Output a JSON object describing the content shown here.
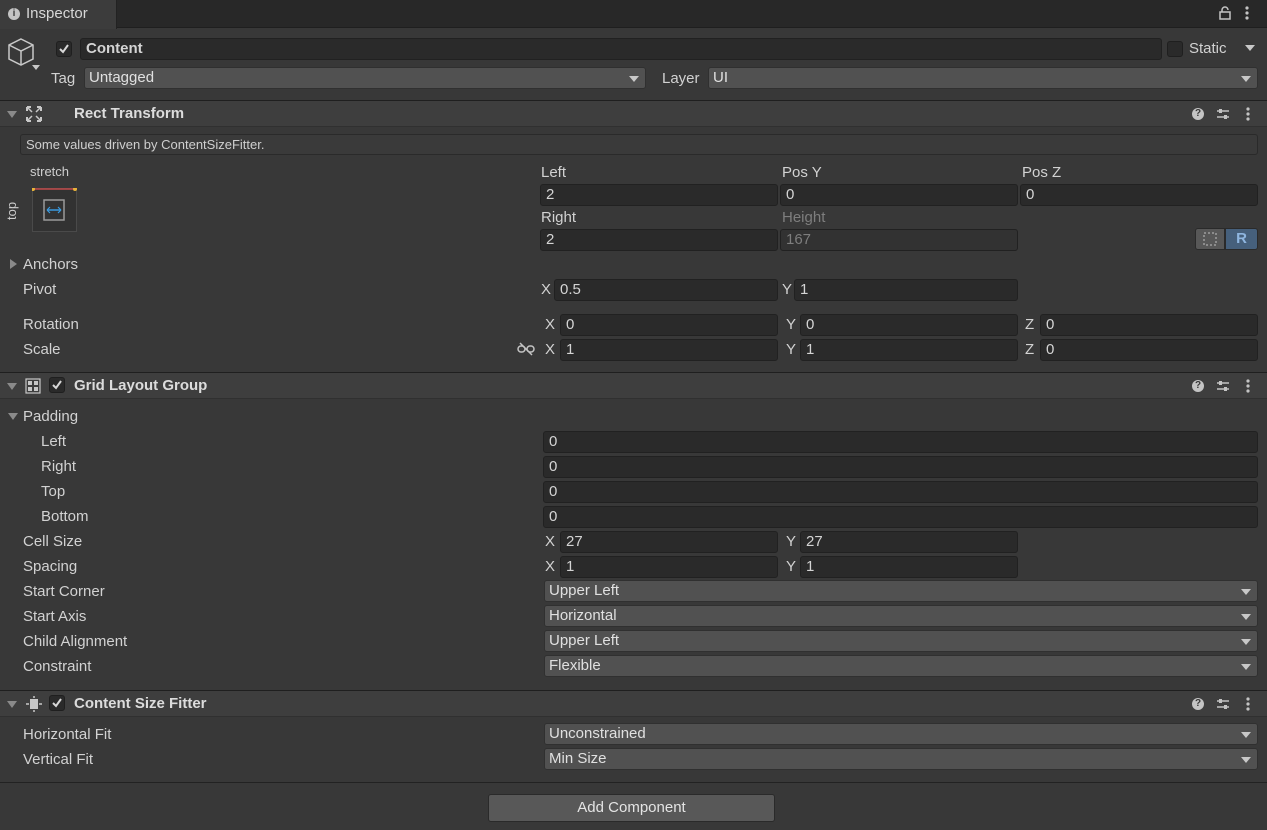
{
  "tab": {
    "label": "Inspector"
  },
  "gameobject": {
    "name": "Content",
    "active": true,
    "static_label": "Static",
    "tag_label": "Tag",
    "tag_value": "Untagged",
    "layer_label": "Layer",
    "layer_value": "UI"
  },
  "rect_transform": {
    "title": "Rect Transform",
    "info": "Some values driven by ContentSizeFitter.",
    "anchor_h": "stretch",
    "anchor_v": "top",
    "col1_label": "Left",
    "col2_label": "Pos Y",
    "col3_label": "Pos Z",
    "left": "2",
    "pos_y": "0",
    "pos_z": "0",
    "row2_col1_label": "Right",
    "row2_col2_label": "Height",
    "right": "2",
    "height": "167",
    "raw_btn": "R",
    "anchors_label": "Anchors",
    "pivot_label": "Pivot",
    "pivot_x": "0.5",
    "pivot_y": "1",
    "rotation_label": "Rotation",
    "rot_x": "0",
    "rot_y": "0",
    "rot_z": "0",
    "scale_label": "Scale",
    "scale_x": "1",
    "scale_y": "1",
    "scale_z": "0",
    "x": "X",
    "y": "Y",
    "z": "Z"
  },
  "grid_layout": {
    "title": "Grid Layout Group",
    "enabled": true,
    "padding_label": "Padding",
    "left_label": "Left",
    "left": "0",
    "right_label": "Right",
    "right": "0",
    "top_label": "Top",
    "top": "0",
    "bottom_label": "Bottom",
    "bottom": "0",
    "cell_size_label": "Cell Size",
    "cell_x": "27",
    "cell_y": "27",
    "spacing_label": "Spacing",
    "spacing_x": "1",
    "spacing_y": "1",
    "start_corner_label": "Start Corner",
    "start_corner": "Upper Left",
    "start_axis_label": "Start Axis",
    "start_axis": "Horizontal",
    "child_alignment_label": "Child Alignment",
    "child_alignment": "Upper Left",
    "constraint_label": "Constraint",
    "constraint": "Flexible"
  },
  "content_size_fitter": {
    "title": "Content Size Fitter",
    "enabled": true,
    "horizontal_fit_label": "Horizontal Fit",
    "horizontal_fit": "Unconstrained",
    "vertical_fit_label": "Vertical Fit",
    "vertical_fit": "Min Size"
  },
  "add_component": {
    "label": "Add Component"
  },
  "colors": {
    "background": "#383838",
    "field": "#2a2a2a",
    "accent": "#3a79bb"
  }
}
